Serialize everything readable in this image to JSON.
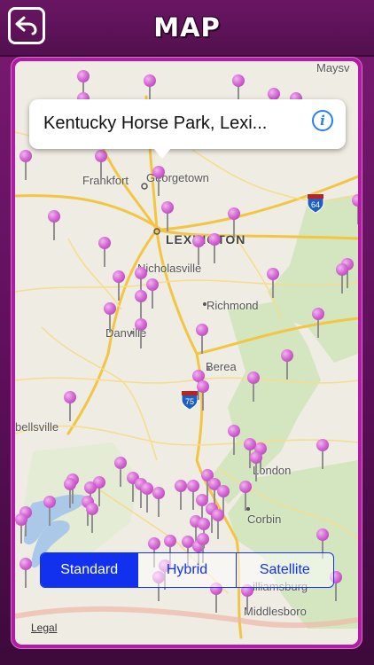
{
  "header": {
    "title": "MAP",
    "back_icon": "back-arrow-icon"
  },
  "callout": {
    "text": "Kentucky Horse Park, Lexi...",
    "info_icon": "info-icon"
  },
  "map_type": {
    "options": [
      "Standard",
      "Hybrid",
      "Satellite"
    ],
    "selected": "Standard"
  },
  "legal": "Legal",
  "cities": [
    {
      "name": "Frankfort"
    },
    {
      "name": "Georgetown"
    },
    {
      "name": "LEXINGTON"
    },
    {
      "name": "Nicholasville"
    },
    {
      "name": "Richmond"
    },
    {
      "name": "Danville"
    },
    {
      "name": "Berea"
    },
    {
      "name": "London"
    },
    {
      "name": "Corbin"
    },
    {
      "name": "bellsville"
    },
    {
      "name": "illiamsburg"
    },
    {
      "name": "Middlesboro"
    },
    {
      "name": "Maysv"
    }
  ],
  "highways": [
    {
      "label": "64"
    },
    {
      "label": "75"
    }
  ],
  "colors": {
    "header_bg": "#5e0f5a",
    "frame": "#b31aa6",
    "accent_blue": "#1131ee",
    "pin": "#d66bd5"
  }
}
